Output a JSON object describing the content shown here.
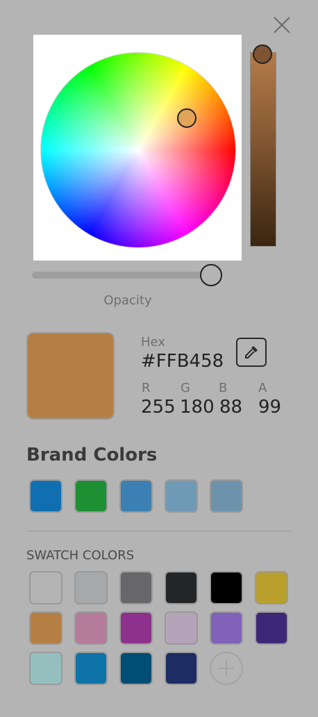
{
  "opacity_label": "Opacity",
  "opacity_value": 0.99,
  "hex_label": "Hex",
  "hex_value": "#FFB458",
  "channels": {
    "r": {
      "label": "R",
      "value": "255"
    },
    "g": {
      "label": "G",
      "value": "180"
    },
    "b": {
      "label": "B",
      "value": "88"
    },
    "a": {
      "label": "A",
      "value": "99"
    }
  },
  "preview_color": "#b47f45",
  "brand_title": "Brand Colors",
  "brand_colors": [
    "#0f6fb0",
    "#1f8f34",
    "#3a80b2",
    "#6f9ab6",
    "#6d93ac"
  ],
  "swatch_title": "SWATCH COLORS",
  "swatch_colors": [
    "#b4b4b4",
    "#a7a8aa",
    "#676669",
    "#242527",
    "#000000",
    "#b9a02c",
    "#b57f43",
    "#b57c9c",
    "#8e318c",
    "#b4a3b9",
    "#8062b8",
    "#3b2876",
    "#95bfbf",
    "#0e73a6",
    "#004d76",
    "#1d2d63"
  ],
  "icons": {
    "close": "close-icon",
    "eyedropper": "eyedropper-icon",
    "add": "plus-icon"
  }
}
